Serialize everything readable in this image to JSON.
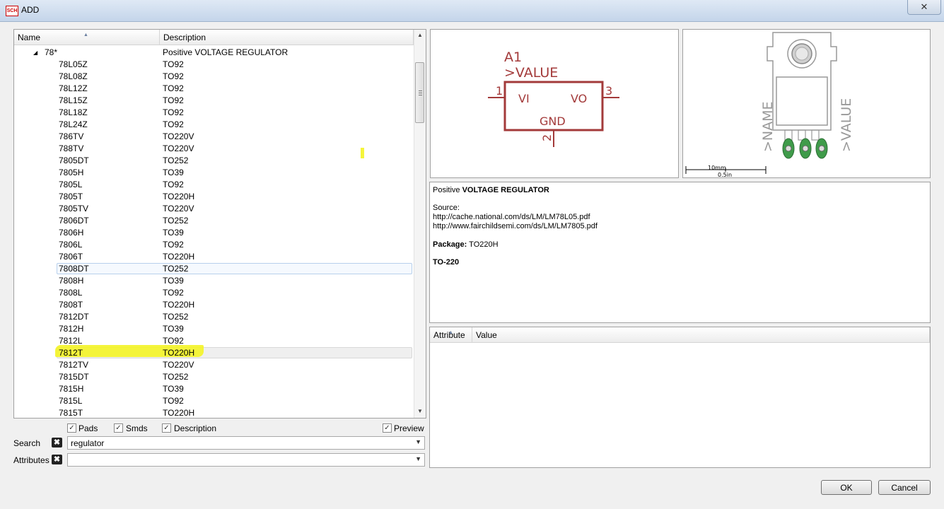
{
  "window": {
    "title": "ADD",
    "app_icon_text": "SCH",
    "close_glyph": "✕"
  },
  "list": {
    "columns": [
      "Name",
      "Description"
    ],
    "parent": {
      "name": "78*",
      "description": "Positive VOLTAGE REGULATOR",
      "expander": "◢"
    },
    "rows": [
      {
        "name": "78L05Z",
        "package": "TO92"
      },
      {
        "name": "78L08Z",
        "package": "TO92"
      },
      {
        "name": "78L12Z",
        "package": "TO92"
      },
      {
        "name": "78L15Z",
        "package": "TO92"
      },
      {
        "name": "78L18Z",
        "package": "TO92"
      },
      {
        "name": "78L24Z",
        "package": "TO92"
      },
      {
        "name": "786TV",
        "package": "TO220V"
      },
      {
        "name": "788TV",
        "package": "TO220V"
      },
      {
        "name": "7805DT",
        "package": "TO252"
      },
      {
        "name": "7805H",
        "package": "TO39"
      },
      {
        "name": "7805L",
        "package": "TO92"
      },
      {
        "name": "7805T",
        "package": "TO220H"
      },
      {
        "name": "7805TV",
        "package": "TO220V"
      },
      {
        "name": "7806DT",
        "package": "TO252"
      },
      {
        "name": "7806H",
        "package": "TO39"
      },
      {
        "name": "7806L",
        "package": "TO92"
      },
      {
        "name": "7806T",
        "package": "TO220H"
      },
      {
        "name": "7808DT",
        "package": "TO252"
      },
      {
        "name": "7808H",
        "package": "TO39"
      },
      {
        "name": "7808L",
        "package": "TO92"
      },
      {
        "name": "7808T",
        "package": "TO220H"
      },
      {
        "name": "7812DT",
        "package": "TO252"
      },
      {
        "name": "7812H",
        "package": "TO39"
      },
      {
        "name": "7812L",
        "package": "TO92"
      },
      {
        "name": "7812T",
        "package": "TO220H"
      },
      {
        "name": "7812TV",
        "package": "TO220V"
      },
      {
        "name": "7815DT",
        "package": "TO252"
      },
      {
        "name": "7815H",
        "package": "TO39"
      },
      {
        "name": "7815L",
        "package": "TO92"
      },
      {
        "name": "7815T",
        "package": "TO220H"
      }
    ],
    "selected_name": "7808DT",
    "hovered_name": "7812T",
    "highlight_color": "#f4f426"
  },
  "filters": {
    "pads_label": "Pads",
    "smds_label": "Smds",
    "description_label": "Description",
    "preview_label": "Preview",
    "check_glyph": "✓"
  },
  "search": {
    "label": "Search",
    "value": "regulator",
    "clear_glyph": "✖",
    "dropdown_glyph": "▼"
  },
  "attributes_filter": {
    "label": "Attributes",
    "value": ""
  },
  "symbol": {
    "name": "A1",
    "value": ">VALUE",
    "pin_vi": "VI",
    "pin_vo": "VO",
    "pin_gnd": "GND",
    "pin1": "1",
    "pin2": "2",
    "pin3": "3",
    "color": "#a33a3a"
  },
  "package_preview": {
    "name_label": ">NAME",
    "value_label": ">VALUE",
    "scale_mm": "10mm",
    "scale_in": "0.5in"
  },
  "description": {
    "title_prefix": "Positive ",
    "title_bold": "VOLTAGE REGULATOR",
    "source_label": "Source:",
    "url1": "http://cache.national.com/ds/LM/LM78L05.pdf",
    "url2": "http://www.fairchildsemi.com/ds/LM/LM7805.pdf",
    "package_label": "Package:",
    "package_value": " TO220H",
    "package_name": "TO-220"
  },
  "attributes_table": {
    "columns": [
      "Attribute",
      "Value"
    ]
  },
  "buttons": {
    "ok": "OK",
    "cancel": "Cancel"
  }
}
